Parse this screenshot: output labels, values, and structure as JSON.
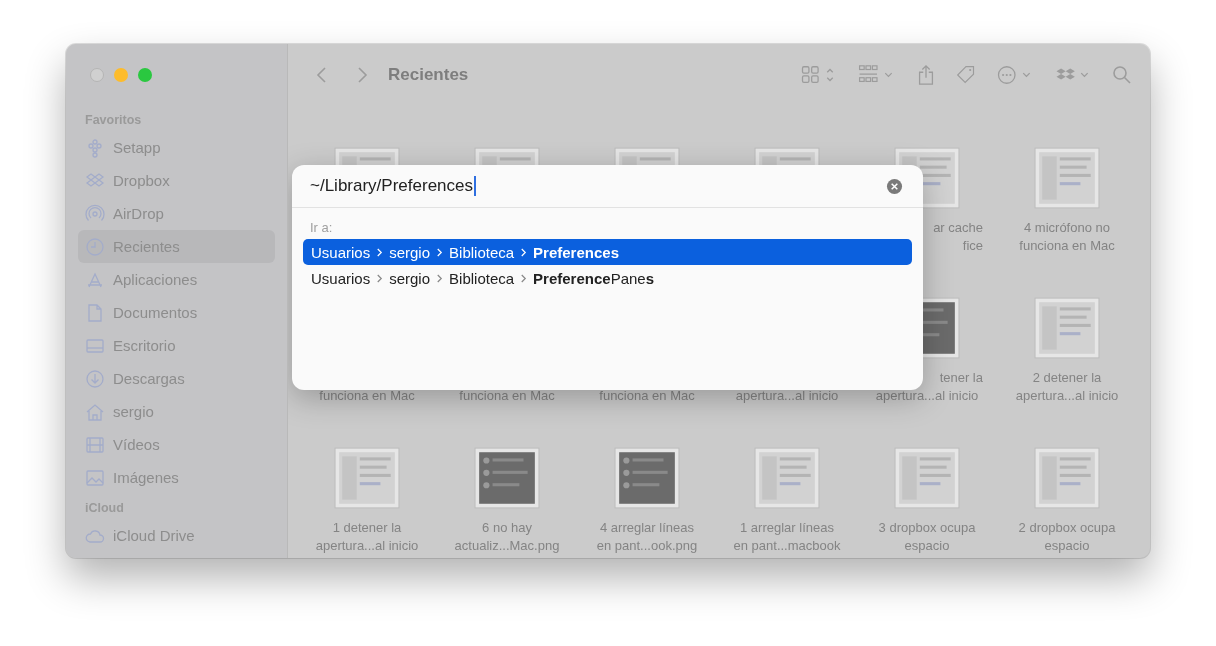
{
  "window": {
    "title": "Recientes"
  },
  "sidebar": {
    "sections": [
      {
        "heading": "Favoritos",
        "items": [
          {
            "label": "Setapp",
            "selected": false
          },
          {
            "label": "Dropbox",
            "selected": false
          },
          {
            "label": "AirDrop",
            "selected": false
          },
          {
            "label": "Recientes",
            "selected": true
          },
          {
            "label": "Aplicaciones",
            "selected": false
          },
          {
            "label": "Documentos",
            "selected": false
          },
          {
            "label": "Escritorio",
            "selected": false
          },
          {
            "label": "Descargas",
            "selected": false
          },
          {
            "label": "sergio",
            "selected": false
          },
          {
            "label": "Vídeos",
            "selected": false
          },
          {
            "label": "Imágenes",
            "selected": false
          }
        ]
      },
      {
        "heading": "iCloud",
        "items": [
          {
            "label": "iCloud Drive",
            "selected": false
          }
        ]
      }
    ]
  },
  "files": [
    {
      "kind": "light"
    },
    {
      "kind": "light"
    },
    {
      "kind": "light"
    },
    {
      "kind": "light"
    },
    {
      "kind": "light",
      "lines": [
        {
          "text": "ar cache",
          "partly_covered": true
        },
        {
          "text": "fice",
          "partly_covered": true
        }
      ]
    },
    {
      "kind": "light",
      "lines": [
        {
          "text": "4 micrófono no"
        },
        {
          "text": "funciona en Mac"
        }
      ]
    },
    {
      "kind": "covered",
      "lines": [
        {
          "text": "funciona en Mac"
        }
      ]
    },
    {
      "kind": "covered",
      "lines": [
        {
          "text": "funciona en Mac"
        }
      ]
    },
    {
      "kind": "covered",
      "lines": [
        {
          "text": "funciona en Mac"
        }
      ]
    },
    {
      "kind": "covered",
      "lines": [
        {
          "text": "apertura...al inicio"
        }
      ]
    },
    {
      "kind": "dark",
      "lines": [
        {
          "text": "tener la",
          "partly_covered": true
        },
        {
          "text": "apertura...al inicio"
        }
      ]
    },
    {
      "kind": "light",
      "lines": [
        {
          "text": "2 detener la"
        },
        {
          "text": "apertura...al inicio"
        }
      ]
    },
    {
      "kind": "light",
      "lines": [
        {
          "text": "1 detener la"
        },
        {
          "text": "apertura...al inicio"
        }
      ]
    },
    {
      "kind": "dark",
      "lines": [
        {
          "text": "6 no hay"
        },
        {
          "text": "actualiz...Mac.png"
        }
      ]
    },
    {
      "kind": "dark",
      "lines": [
        {
          "text": "4 arreglar líneas"
        },
        {
          "text": "en pant...ook.png"
        }
      ]
    },
    {
      "kind": "light",
      "lines": [
        {
          "text": "1 arreglar líneas"
        },
        {
          "text": "en pant...macbook"
        }
      ]
    },
    {
      "kind": "light",
      "lines": [
        {
          "text": "3 dropbox ocupa"
        },
        {
          "text": "espacio"
        }
      ]
    },
    {
      "kind": "light",
      "lines": [
        {
          "text": "2 dropbox ocupa"
        },
        {
          "text": "espacio"
        }
      ]
    }
  ],
  "go_to_dialog": {
    "value": "~/Library/Preferences",
    "section_label": "Ir a:",
    "results": [
      {
        "segments": [
          "Usuarios",
          "sergio",
          "Biblioteca",
          "**Preferences**"
        ],
        "selected": true
      },
      {
        "segments": [
          "Usuarios",
          "sergio",
          "Biblioteca",
          "**Preference**Pane**s**"
        ],
        "selected": false
      }
    ]
  }
}
